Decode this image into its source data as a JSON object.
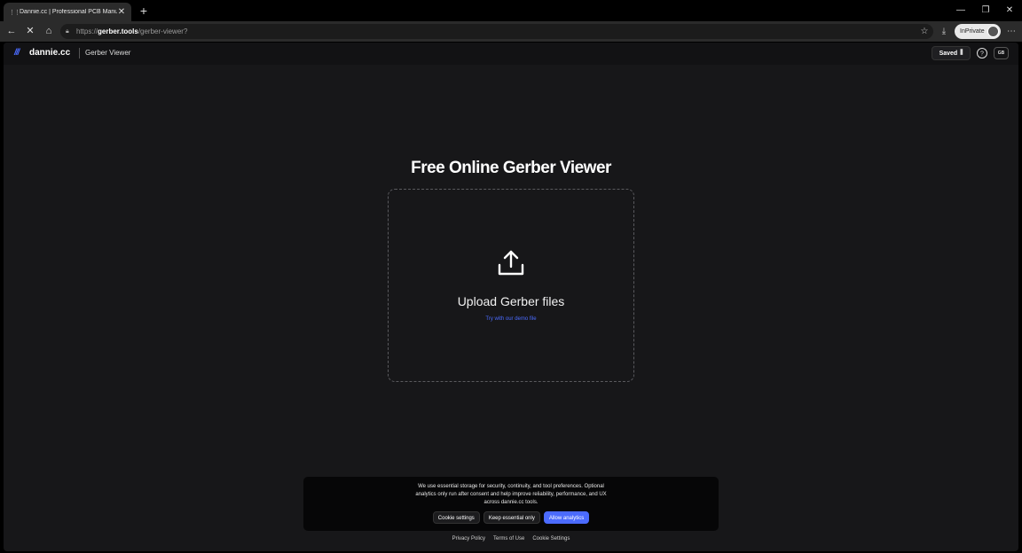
{
  "browser": {
    "tab_title": "Dannie.cc | Professional PCB Manu",
    "tab_favicon": "⋮⋮",
    "tab_close": "✕",
    "new_tab": "+",
    "win_minimize": "—",
    "win_restore": "❐",
    "win_close": "✕",
    "back": "←",
    "stop": "✕",
    "home": "⌂",
    "url_scheme": "https://",
    "url_domain": "gerber.tools",
    "url_path": "/gerber-viewer?",
    "favorite_icon": "☆",
    "download_icon": "⤓",
    "inprivate_label": "InPrivate",
    "more_icon": "⋯"
  },
  "header": {
    "brand_mark": "///",
    "brand_name": "dannie.cc",
    "product": "Gerber Viewer",
    "saved_label": "Saved",
    "saved_icon": "⫼",
    "help_icon": "?",
    "lang_label": "GB"
  },
  "main": {
    "title": "Free Online Gerber Viewer",
    "upload_label": "Upload Gerber files",
    "demo_link": "Try with our demo file"
  },
  "cookie": {
    "text": "We use essential storage for security, continuity, and tool preferences. Optional analytics only run after consent and help improve reliability, performance, and UX across dannie.cc tools.",
    "settings": "Cookie settings",
    "essential": "Keep essential only",
    "allow": "Allow analytics"
  },
  "footer": {
    "privacy": "Privacy Policy",
    "terms": "Terms of Use",
    "cookie_settings": "Cookie Settings"
  },
  "colors": {
    "accent": "#4b6bff",
    "background": "#171719"
  }
}
